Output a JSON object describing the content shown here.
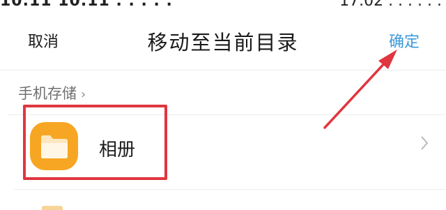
{
  "status_bar": {
    "left_text": "10.11 10.11 . . . . . ",
    "right_text": "17.02 . . . . . . "
  },
  "header": {
    "cancel_label": "取消",
    "title": "移动至当前目录",
    "confirm_label": "确定"
  },
  "breadcrumb": {
    "label": "手机存储",
    "chevron": "›"
  },
  "folders": [
    {
      "name": "相册",
      "icon": "folder-icon"
    }
  ],
  "colors": {
    "accent": "#3b9ad9",
    "folder_orange": "#f7a623",
    "annotation_red": "#e0363f"
  }
}
